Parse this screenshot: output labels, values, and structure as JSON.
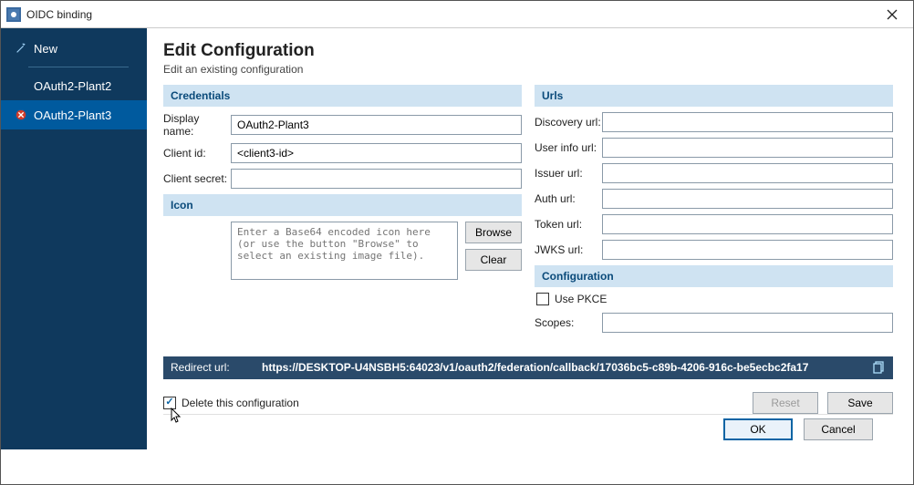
{
  "window": {
    "title": "OIDC binding"
  },
  "sidebar": {
    "new_label": "New",
    "items": [
      {
        "label": "OAuth2-Plant2",
        "status": "none",
        "selected": false
      },
      {
        "label": "OAuth2-Plant3",
        "status": "error",
        "selected": true
      }
    ]
  },
  "page": {
    "title": "Edit Configuration",
    "subtitle": "Edit an existing configuration"
  },
  "sections": {
    "credentials": "Credentials",
    "icon": "Icon",
    "urls": "Urls",
    "configuration": "Configuration"
  },
  "labels": {
    "display_name": "Display name:",
    "client_id": "Client id:",
    "client_secret": "Client secret:",
    "discovery_url": "Discovery url:",
    "userinfo_url": "User info url:",
    "issuer_url": "Issuer url:",
    "auth_url": "Auth url:",
    "token_url": "Token url:",
    "jwks_url": "JWKS url:",
    "scopes": "Scopes:",
    "use_pkce": "Use PKCE",
    "redirect_url": "Redirect url:"
  },
  "fields": {
    "display_name": "OAuth2-Plant3",
    "client_id": "<client3-id>",
    "client_secret": "",
    "discovery_url": "",
    "userinfo_url": "",
    "issuer_url": "",
    "auth_url": "",
    "token_url": "",
    "jwks_url": "",
    "scopes": "",
    "use_pkce": false,
    "icon_placeholder": "Enter a Base64 encoded icon here (or use the button \"Browse\" to select an existing image file)."
  },
  "buttons": {
    "browse": "Browse",
    "clear": "Clear",
    "reset": "Reset",
    "save": "Save",
    "ok": "OK",
    "cancel": "Cancel"
  },
  "delete_checkbox": {
    "label": "Delete this configuration",
    "checked": true
  },
  "redirect_url": "https://DESKTOP-U4NSBH5:64023/v1/oauth2/federation/callback/17036bc5-c89b-4206-916c-be5ecbc2fa17"
}
